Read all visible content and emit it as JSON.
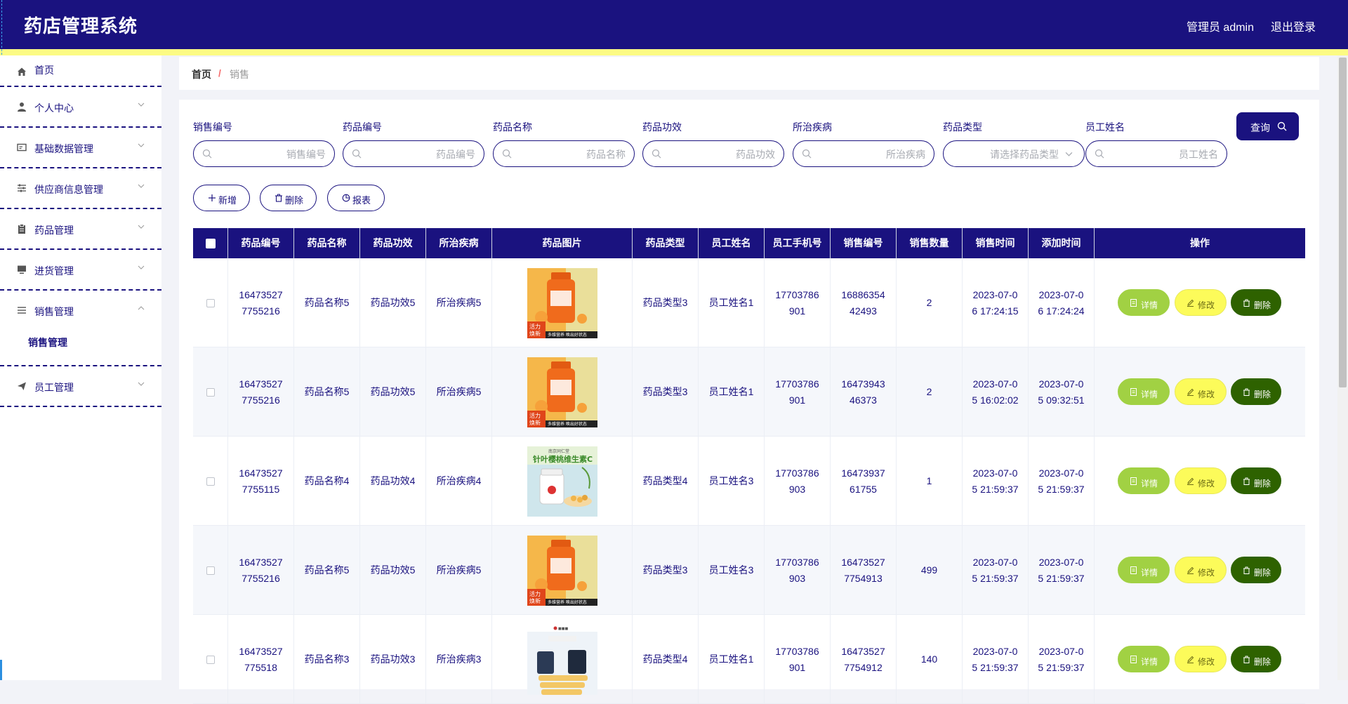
{
  "app": {
    "title": "药店管理系统",
    "user": "管理员 admin",
    "logout": "退出登录"
  },
  "sidebar": {
    "items": [
      {
        "label": "首页",
        "icon": "home-icon"
      },
      {
        "label": "个人中心",
        "icon": "user-icon"
      },
      {
        "label": "基础数据管理",
        "icon": "card-icon"
      },
      {
        "label": "供应商信息管理",
        "icon": "sliders-icon"
      },
      {
        "label": "药品管理",
        "icon": "clipboard-icon"
      },
      {
        "label": "进货管理",
        "icon": "monitor-icon"
      },
      {
        "label": "销售管理",
        "icon": "list-icon"
      },
      {
        "label": "员工管理",
        "icon": "send-icon"
      }
    ],
    "sub_items": [
      "销售管理"
    ]
  },
  "breadcrumb": {
    "home": "首页",
    "separator": "/",
    "current": "销售"
  },
  "filters": [
    {
      "label": "销售编号",
      "placeholder": "销售编号"
    },
    {
      "label": "药品编号",
      "placeholder": "药品编号"
    },
    {
      "label": "药品名称",
      "placeholder": "药品名称"
    },
    {
      "label": "药品功效",
      "placeholder": "药品功效"
    },
    {
      "label": "所治疾病",
      "placeholder": "所治疾病"
    },
    {
      "label": "药品类型",
      "placeholder": "请选择药品类型"
    },
    {
      "label": "员工姓名",
      "placeholder": "员工姓名"
    }
  ],
  "query_label": "查询",
  "actions": {
    "add": "新增",
    "delete": "删除",
    "report": "报表"
  },
  "table": {
    "headers": [
      "药品编号",
      "药品名称",
      "药品功效",
      "所治疾病",
      "药品图片",
      "药品类型",
      "员工姓名",
      "员工手机号",
      "销售编号",
      "销售数量",
      "销售时间",
      "添加时间",
      "操作"
    ],
    "ops": {
      "detail": "详情",
      "edit": "修改",
      "delete": "删除"
    },
    "rows": [
      {
        "drug_no": "1647352777 55216",
        "drug_no_display": "16473527\n7755216",
        "name": "药品名称5",
        "effect": "药品功效5",
        "disease": "所治疾病5",
        "image": "orange-bottle",
        "type": "药品类型3",
        "staff": "员工姓名1",
        "phone": "17703786\n901",
        "sale_no": "16886354\n42493",
        "qty": "2",
        "sale_time": "2023-07-0\n6 17:24:15",
        "add_time": "2023-07-0\n6 17:24:24"
      },
      {
        "drug_no": "",
        "drug_no_display": "16473527\n7755216",
        "name": "药品名称5",
        "effect": "药品功效5",
        "disease": "所治疾病5",
        "image": "orange-bottle",
        "type": "药品类型3",
        "staff": "员工姓名1",
        "phone": "17703786\n901",
        "sale_no": "16473943\n46373",
        "qty": "2",
        "sale_time": "2023-07-0\n5 16:02:02",
        "add_time": "2023-07-0\n5 09:32:51"
      },
      {
        "drug_no": "",
        "drug_no_display": "16473527\n7755115",
        "name": "药品名称4",
        "effect": "药品功效4",
        "disease": "所治疾病4",
        "image": "vitamin-c",
        "type": "药品类型4",
        "staff": "员工姓名3",
        "phone": "17703786\n903",
        "sale_no": "16473937\n61755",
        "qty": "1",
        "sale_time": "2023-07-0\n5 21:59:37",
        "add_time": "2023-07-0\n5 21:59:37"
      },
      {
        "drug_no": "",
        "drug_no_display": "16473527\n7755216",
        "name": "药品名称5",
        "effect": "药品功效5",
        "disease": "所治疾病5",
        "image": "orange-bottle",
        "type": "药品类型3",
        "staff": "员工姓名3",
        "phone": "17703786\n903",
        "sale_no": "16473527\n7754913",
        "qty": "499",
        "sale_time": "2023-07-0\n5 21:59:37",
        "add_time": "2023-07-0\n5 21:59:37"
      },
      {
        "drug_no": "",
        "drug_no_display": "16473527\n775518",
        "name": "药品名称3",
        "effect": "药品功效3",
        "disease": "所治疾病3",
        "image": "supplements",
        "type": "药品类型4",
        "staff": "员工姓名1",
        "phone": "17703786\n901",
        "sale_no": "16473527\n7754912",
        "qty": "140",
        "sale_time": "2023-07-0\n5 21:59:37",
        "add_time": "2023-07-0\n5 21:59:37"
      }
    ]
  },
  "image_texts": {
    "orange_badge": "活力\n焕新",
    "orange_slogan": "多维营养 唤出好状态",
    "vitamin_c_brand": "南京同仁堂",
    "vitamin_c_title": "针叶樱桃维生素C"
  },
  "colors": {
    "primary": "#1a127f",
    "accent_yellow": "#fcfb84",
    "detail": "#a1d143",
    "edit": "#fcfb5a",
    "delete": "#2e6200"
  }
}
